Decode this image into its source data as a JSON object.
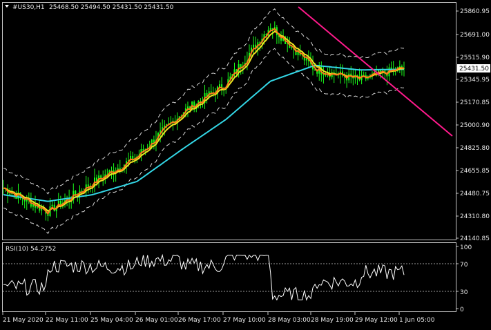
{
  "chart_header": {
    "symbol_label": "#US30,H1",
    "ohlc": "25468.50 25494.50 25431.50 25431.50"
  },
  "price_axis": {
    "ticks": [
      "25860.95",
      "25691.00",
      "25515.90",
      "25345.95",
      "25170.85",
      "25000.90",
      "24825.80",
      "24655.85",
      "24480.75",
      "24310.80",
      "24140.85"
    ],
    "current_price": "25431.50"
  },
  "rsi_panel": {
    "label": "RSI(10) 54.2752",
    "ticks": [
      "100",
      "70",
      "30",
      "0"
    ]
  },
  "time_axis": {
    "labels": [
      "21 May 2020",
      "22 May 11:00",
      "25 May 04:00",
      "26 May 01:00",
      "26 May 17:00",
      "27 May 10:00",
      "28 May 03:00",
      "28 May 19:00",
      "29 May 12:00",
      "1 Jun 05:00"
    ]
  },
  "colors": {
    "background": "#000000",
    "candles": "#1aff1a",
    "ma_fast": "#ff7a1a",
    "ma_mid": "#f0e020",
    "ma_slow": "#33d7e6",
    "bands": "#d8d8d8",
    "trendline": "#ff1a8c",
    "rsi_line": "#ffffff",
    "price_box": "#ffffff",
    "grid_level": "#9a9a9a"
  },
  "chart_data": {
    "type": "line",
    "title": "#US30,H1",
    "ylim": [
      24140.85,
      25960
    ],
    "x": [
      "21 May 2020",
      "22 May 11:00",
      "25 May 04:00",
      "26 May 01:00",
      "26 May 17:00",
      "27 May 10:00",
      "28 May 03:00",
      "28 May 19:00",
      "29 May 12:00",
      "1 Jun 05:00"
    ],
    "series": [
      {
        "name": "close",
        "values": [
          24520,
          24340,
          24560,
          24760,
          25090,
          25310,
          25750,
          25420,
          25340,
          25431.5
        ]
      },
      {
        "name": "slow MA",
        "values": [
          24470,
          24420,
          24470,
          24570,
          24810,
          25040,
          25330,
          25450,
          25415,
          25420
        ]
      }
    ],
    "rsi": {
      "name": "RSI(10)",
      "last": 54.2752,
      "levels": [
        30,
        70
      ],
      "range": [
        0,
        100
      ]
    }
  }
}
